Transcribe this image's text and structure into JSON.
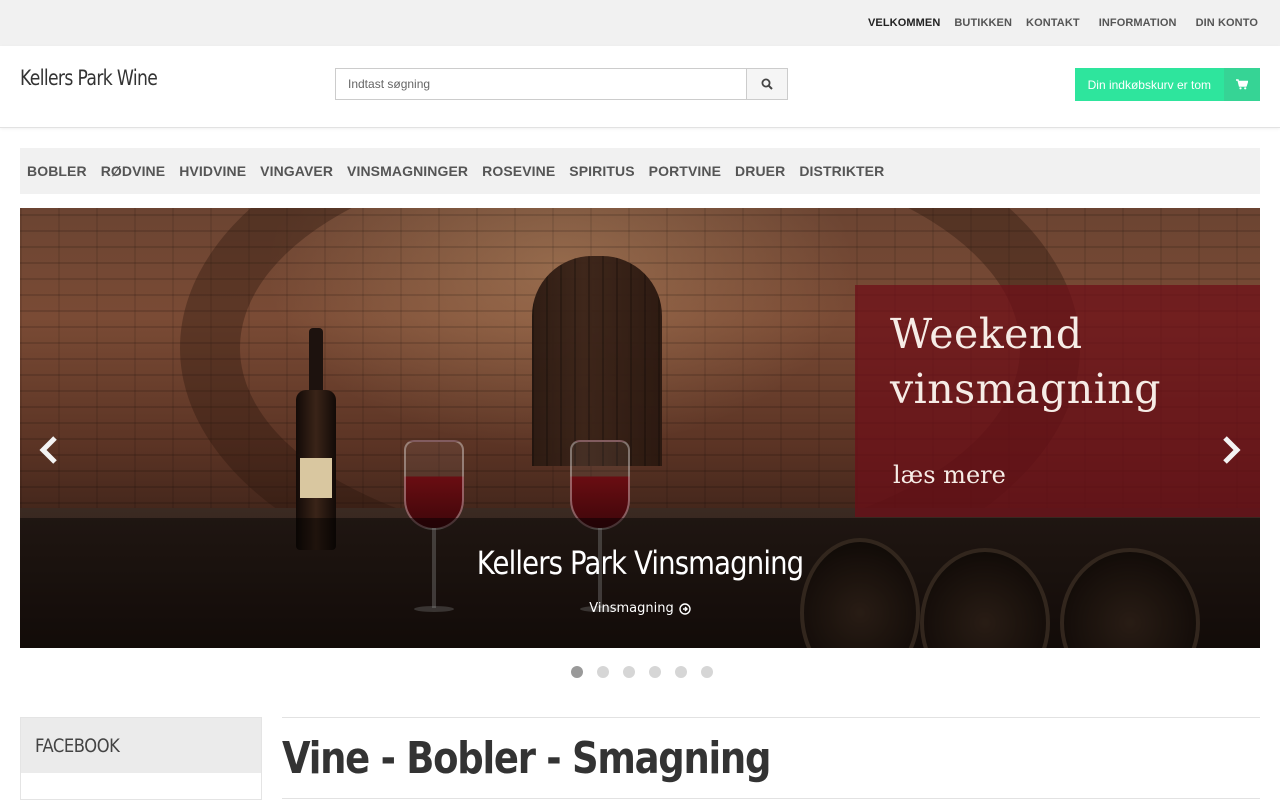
{
  "top_nav": {
    "items": [
      {
        "label": "VELKOMMEN",
        "active": true
      },
      {
        "label": "BUTIKKEN"
      },
      {
        "label": "KONTAKT"
      },
      {
        "label": "INFORMATION"
      },
      {
        "label": "DIN KONTO"
      }
    ]
  },
  "header": {
    "logo": "Kellers Park Wine",
    "search": {
      "placeholder": "Indtast søgning",
      "icon": "search-icon"
    },
    "cart": {
      "label": "Din indkøbskurv er tom",
      "icon": "cart-icon",
      "color": "#2ee59d"
    }
  },
  "main_nav": {
    "items": [
      "BOBLER",
      "RØDVINE",
      "HVIDVINE",
      "VINGAVER",
      "VINSMAGNINGER",
      "ROSEVINE",
      "SPIRITUS",
      "PORTVINE",
      "DRUER",
      "DISTRIKTER"
    ]
  },
  "hero": {
    "overlay_title": "Weekend vinsmagning",
    "overlay_link": "læs mere",
    "caption_title": "Kellers Park Vinsmagning",
    "caption_link": "Vinsmagning",
    "prev_icon": "chevron-left-icon",
    "next_icon": "chevron-right-icon",
    "slide_count": 6,
    "active_slide": 1
  },
  "sidebar": {
    "heading": "FACEBOOK"
  },
  "content": {
    "title": "Vine - Bobler - Smagning"
  }
}
